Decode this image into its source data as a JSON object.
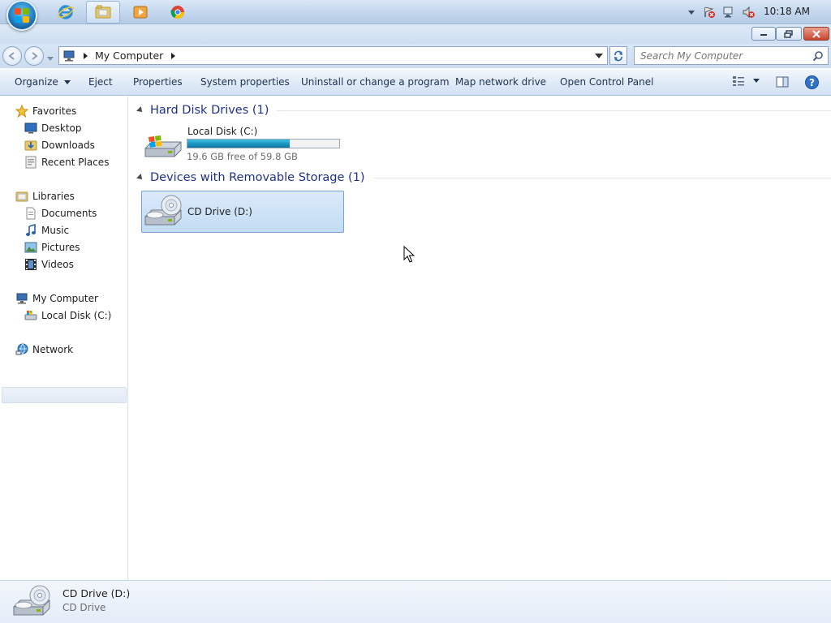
{
  "taskbar": {
    "clock": "10:18 AM",
    "apps": [
      {
        "name": "internet-explorer"
      },
      {
        "name": "windows-explorer",
        "active": true
      },
      {
        "name": "media-player"
      },
      {
        "name": "chrome"
      }
    ]
  },
  "address": {
    "location": "My Computer",
    "search_placeholder": "Search My Computer"
  },
  "toolbar": {
    "organize": "Organize",
    "eject": "Eject",
    "properties": "Properties",
    "system_properties": "System properties",
    "uninstall": "Uninstall or change a program",
    "map_drive": "Map network drive",
    "control_panel": "Open Control Panel"
  },
  "nav": {
    "favorites": "Favorites",
    "desktop": "Desktop",
    "downloads": "Downloads",
    "recent": "Recent Places",
    "libraries": "Libraries",
    "documents": "Documents",
    "music": "Music",
    "pictures": "Pictures",
    "videos": "Videos",
    "my_computer": "My Computer",
    "local_disk": "Local Disk (C:)",
    "network": "Network"
  },
  "content": {
    "hdd_group": "Hard Disk Drives (1)",
    "removable_group": "Devices with Removable Storage (1)",
    "local_disk_name": "Local Disk (C:)",
    "local_disk_free": "19.6 GB free of 59.8 GB",
    "local_disk_used_fraction": 0.672,
    "cd_drive_name": "CD Drive (D:)"
  },
  "details": {
    "name": "CD Drive (D:)",
    "type": "CD Drive"
  },
  "colors": {
    "selection": "#cde3f8",
    "capacity_bar": "#1a91bf",
    "group_header": "#1e3287"
  }
}
